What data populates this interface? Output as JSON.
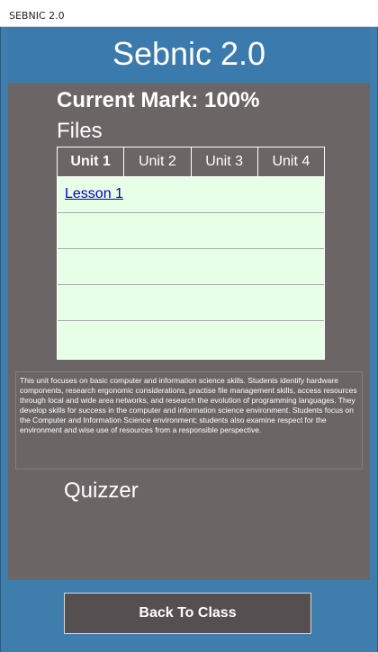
{
  "window": {
    "title": "SEBNIC 2.0"
  },
  "header": {
    "app_title": "Sebnic 2.0"
  },
  "current_mark": {
    "label": "Current Mark: 100%"
  },
  "files": {
    "heading": "Files",
    "tabs": [
      {
        "label": "Unit 1",
        "active": true
      },
      {
        "label": "Unit 2",
        "active": false
      },
      {
        "label": "Unit 3",
        "active": false
      },
      {
        "label": "Unit 4",
        "active": false
      }
    ],
    "rows": [
      {
        "link": "Lesson 1"
      },
      {
        "link": ""
      },
      {
        "link": ""
      },
      {
        "link": ""
      },
      {
        "link": ""
      }
    ]
  },
  "description": "This unit focuses on basic computer and information science skills. Students identify hardware components, research ergonomic considerations, practise file management skills, access resources through local and wide area networks, and research the evolution of programming languages. They develop skills for success in the computer and information science environment. Students focus on the Computer and Information Science environment; students also examine respect for the environment and wise use of resources from a responsible perspective.",
  "quizzer": {
    "heading": "Quizzer"
  },
  "footer": {
    "back_button": "Back To Class"
  }
}
